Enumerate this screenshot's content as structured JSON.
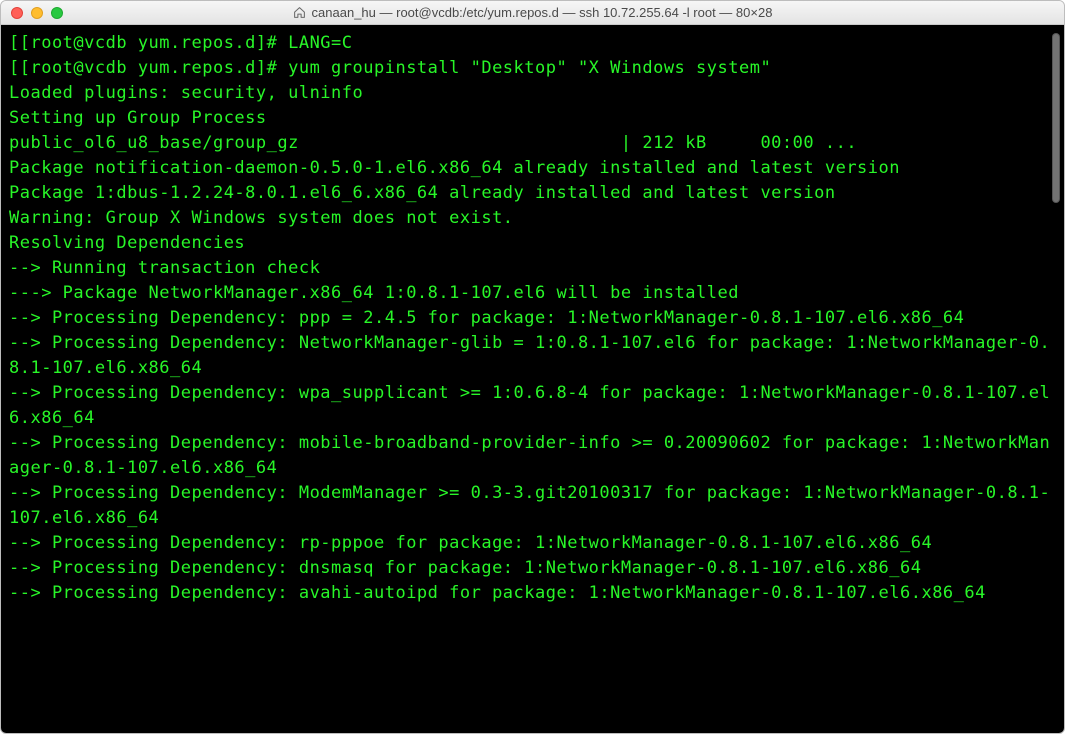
{
  "window": {
    "title": "canaan_hu — root@vcdb:/etc/yum.repos.d — ssh 10.72.255.64 -l root — 80×28"
  },
  "terminal": {
    "lines": [
      "[[root@vcdb yum.repos.d]# LANG=C",
      "[[root@vcdb yum.repos.d]# yum groupinstall \"Desktop\" \"X Windows system\"",
      "Loaded plugins: security, ulninfo",
      "Setting up Group Process",
      "public_ol6_u8_base/group_gz                              | 212 kB     00:00 ...",
      "Package notification-daemon-0.5.0-1.el6.x86_64 already installed and latest version",
      "Package 1:dbus-1.2.24-8.0.1.el6_6.x86_64 already installed and latest version",
      "Warning: Group X Windows system does not exist.",
      "Resolving Dependencies",
      "--> Running transaction check",
      "---> Package NetworkManager.x86_64 1:0.8.1-107.el6 will be installed",
      "--> Processing Dependency: ppp = 2.4.5 for package: 1:NetworkManager-0.8.1-107.el6.x86_64",
      "--> Processing Dependency: NetworkManager-glib = 1:0.8.1-107.el6 for package: 1:NetworkManager-0.8.1-107.el6.x86_64",
      "--> Processing Dependency: wpa_supplicant >= 1:0.6.8-4 for package: 1:NetworkManager-0.8.1-107.el6.x86_64",
      "--> Processing Dependency: mobile-broadband-provider-info >= 0.20090602 for package: 1:NetworkManager-0.8.1-107.el6.x86_64",
      "--> Processing Dependency: ModemManager >= 0.3-3.git20100317 for package: 1:NetworkManager-0.8.1-107.el6.x86_64",
      "--> Processing Dependency: rp-pppoe for package: 1:NetworkManager-0.8.1-107.el6.x86_64",
      "--> Processing Dependency: dnsmasq for package: 1:NetworkManager-0.8.1-107.el6.x86_64",
      "--> Processing Dependency: avahi-autoipd for package: 1:NetworkManager-0.8.1-107.el6.x86_64"
    ]
  }
}
